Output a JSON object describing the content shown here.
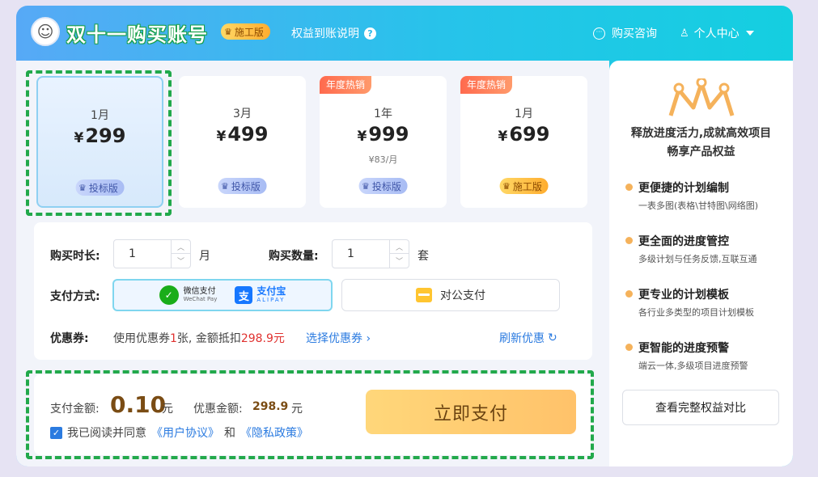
{
  "header": {
    "title": "双十一购买账号",
    "badge": "施工版",
    "rights_link": "权益到账说明",
    "consult": "购买咨询",
    "user_center": "个人中心"
  },
  "plans": [
    {
      "duration": "1月",
      "currency": "¥",
      "price": "299",
      "sub": "",
      "badge": "投标版",
      "hot": "",
      "selected": true
    },
    {
      "duration": "3月",
      "currency": "¥",
      "price": "499",
      "sub": "",
      "badge": "投标版",
      "hot": "",
      "selected": false
    },
    {
      "duration": "1年",
      "currency": "¥",
      "price": "999",
      "sub": "¥83/月",
      "badge": "投标版",
      "hot": "年度热销",
      "selected": false
    },
    {
      "duration": "1月",
      "currency": "¥",
      "price": "699",
      "sub": "",
      "badge": "施工版",
      "hot": "年度热销",
      "selected": false
    }
  ],
  "options": {
    "duration_label": "购买时长:",
    "duration_value": "1",
    "duration_unit": "月",
    "qty_label": "购买数量:",
    "qty_value": "1",
    "qty_unit": "套",
    "payment_label": "支付方式:",
    "wechat_cn": "微信支付",
    "wechat_en": "WeChat Pay",
    "alipay_cn": "支付宝",
    "alipay_en": "ALIPAY",
    "corporate": "对公支付",
    "coupon_label": "优惠券:",
    "coupon_text_prefix": "使用优惠券",
    "coupon_count": "1",
    "coupon_text_mid": "张,  金额抵扣",
    "coupon_amount": "298.9元",
    "select_coupon": "选择优惠券 ›",
    "refresh": "刷新优惠"
  },
  "payment": {
    "amount_label": "支付金额:",
    "amount": "0.10",
    "unit": "元",
    "discount_label": "优惠金额:",
    "discount": "298.9",
    "agree_prefix": "我已阅读并同意",
    "user_agreement": "《用户协议》",
    "and": "和",
    "privacy": "《隐私政策》",
    "pay_button": "立即支付"
  },
  "sidebar": {
    "slogan1": "释放进度活力,成就高效项目",
    "slogan2": "畅享产品权益",
    "benefits": [
      {
        "title": "更便捷的计划编制",
        "desc": "一表多图(表格\\甘特图\\网络图)"
      },
      {
        "title": "更全面的进度管控",
        "desc": "多级计划与任务反馈,互联互通"
      },
      {
        "title": "更专业的计划模板",
        "desc": "各行业多类型的项目计划模板"
      },
      {
        "title": "更智能的进度预警",
        "desc": "端云一体,多级项目进度预警"
      }
    ],
    "compare_button": "查看完整权益对比"
  },
  "colors": {
    "accent_blue": "#2b7be0",
    "highlight_green": "#22a94b",
    "price_brown": "#7a4c14",
    "hot_tag": "#ff6a4e"
  }
}
